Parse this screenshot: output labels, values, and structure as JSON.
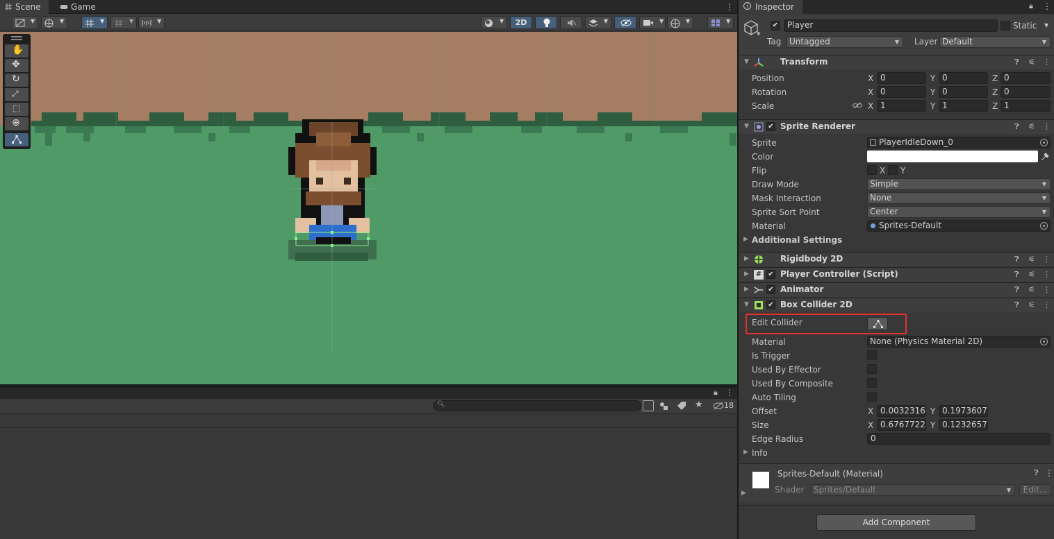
{
  "tabs": {
    "scene": "Scene",
    "game": "Game"
  },
  "scene_toolbar": {
    "mode_2d": "2D"
  },
  "project": {
    "hidden_count": "18"
  },
  "inspector": {
    "tab_label": "Inspector",
    "object": {
      "name": "Player",
      "static_label": "Static",
      "tag_label": "Tag",
      "tag_value": "Untagged",
      "layer_label": "Layer",
      "layer_value": "Default"
    },
    "transform": {
      "title": "Transform",
      "position_label": "Position",
      "rotation_label": "Rotation",
      "scale_label": "Scale",
      "axis_x": "X",
      "axis_y": "Y",
      "axis_z": "Z",
      "position": {
        "x": "0",
        "y": "0",
        "z": "0"
      },
      "rotation": {
        "x": "0",
        "y": "0",
        "z": "0"
      },
      "scale": {
        "x": "1",
        "y": "1",
        "z": "1"
      }
    },
    "sprite_renderer": {
      "title": "Sprite Renderer",
      "sprite_label": "Sprite",
      "sprite_value": "PlayerIdleDown_0",
      "color_label": "Color",
      "color_value": "#ffffff",
      "flip_label": "Flip",
      "flip_x": "X",
      "flip_y": "Y",
      "draw_mode_label": "Draw Mode",
      "draw_mode_value": "Simple",
      "mask_label": "Mask Interaction",
      "mask_value": "None",
      "sort_point_label": "Sprite Sort Point",
      "sort_point_value": "Center",
      "material_label": "Material",
      "material_value": "Sprites-Default",
      "additional": "Additional Settings"
    },
    "components": {
      "rigidbody": "Rigidbody 2D",
      "player_controller": "Player Controller (Script)",
      "animator": "Animator"
    },
    "box_collider": {
      "title": "Box Collider 2D",
      "edit_collider_label": "Edit Collider",
      "material_label": "Material",
      "material_value": "None (Physics Material 2D)",
      "is_trigger_label": "Is Trigger",
      "used_by_effector_label": "Used By Effector",
      "used_by_composite_label": "Used By Composite",
      "auto_tiling_label": "Auto Tiling",
      "offset_label": "Offset",
      "offset_x": "0.0032316",
      "offset_y": "0.1973607",
      "size_label": "Size",
      "size_x": "0.6767722",
      "size_y": "0.1232657",
      "edge_radius_label": "Edge Radius",
      "edge_radius_value": "0",
      "info_label": "Info"
    },
    "material_preview": {
      "name": "Sprites-Default (Material)",
      "shader_label": "Shader",
      "shader_value": "Sprites/Default",
      "edit_button": "Edit..."
    },
    "add_component": "Add Component"
  },
  "colors": {
    "highlight_box": "#e03030",
    "scene_grass": "#4f9a67",
    "scene_dirt": "#a47d62",
    "accent_blue": "#46607c"
  }
}
